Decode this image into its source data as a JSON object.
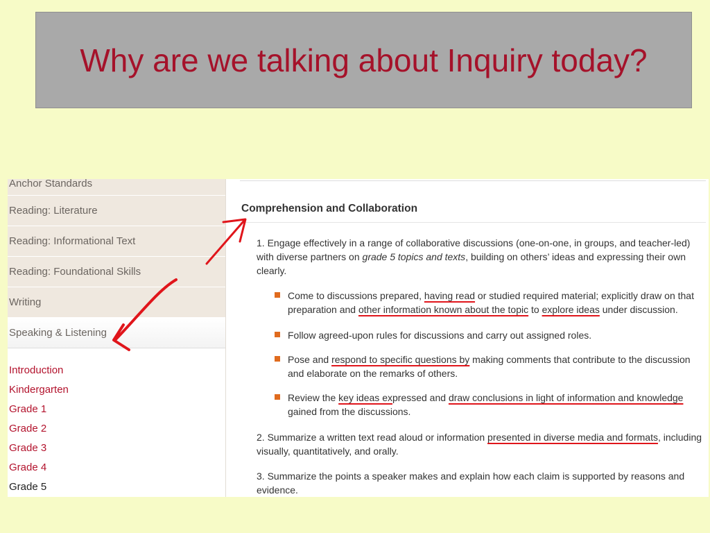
{
  "slide": {
    "title": "Why are we talking about Inquiry today?"
  },
  "sidebar": {
    "items": [
      {
        "label": "Anchor Standards"
      },
      {
        "label": "Reading: Literature"
      },
      {
        "label": "Reading: Informational Text"
      },
      {
        "label": "Reading: Foundational Skills"
      },
      {
        "label": "Writing"
      },
      {
        "label": "Speaking & Listening"
      }
    ],
    "grades": [
      {
        "label": "Introduction"
      },
      {
        "label": "Kindergarten"
      },
      {
        "label": "Grade 1"
      },
      {
        "label": "Grade 2"
      },
      {
        "label": "Grade 3"
      },
      {
        "label": "Grade 4"
      },
      {
        "label": "Grade 5"
      }
    ]
  },
  "content": {
    "heading": "Comprehension and Collaboration",
    "p1": {
      "a": "1. Engage effectively in a range of collaborative discussions (one-on-one, in groups, and teacher-led) with diverse partners on ",
      "em": "grade 5 topics and texts",
      "b": ", building on others’ ideas and expressing their own clearly."
    },
    "b1": {
      "a": "Come to discussions prepared, ",
      "u1": "having read",
      "b": " or studied required material; explicitly draw on that preparation and ",
      "u2": "other information known about the topic",
      "c": " to ",
      "u3": "explore ideas",
      "d": " under discussion."
    },
    "b2": {
      "a": "Follow agreed-upon rules for discussions and carry out assigned roles."
    },
    "b3": {
      "a": "Pose and ",
      "u1": "respond to specific questions by",
      "b": " making comments that contribute to the discussion and elaborate on the remarks of others."
    },
    "b4": {
      "a": "Review the ",
      "u1": "key ideas ex",
      "b": "pressed and ",
      "u2": "draw conclusions in light of information and knowledge",
      "c": " gained from the discussions."
    },
    "p2": {
      "a": "2. Summarize a written text read aloud or information ",
      "u1": "presented in diverse media and formats",
      "b": ", including visually, quantitatively, and orally."
    },
    "p3": {
      "a": "3. Summarize the points a speaker makes and explain how each claim is supported by reasons and evidence."
    }
  },
  "colors": {
    "slide_background": "#f7fbc7",
    "title_box": "#a9a9a9",
    "title_text": "#a5122a",
    "link_red": "#b3132d",
    "annotation_red": "#e0151b",
    "bullet_orange": "#e06b1e"
  }
}
